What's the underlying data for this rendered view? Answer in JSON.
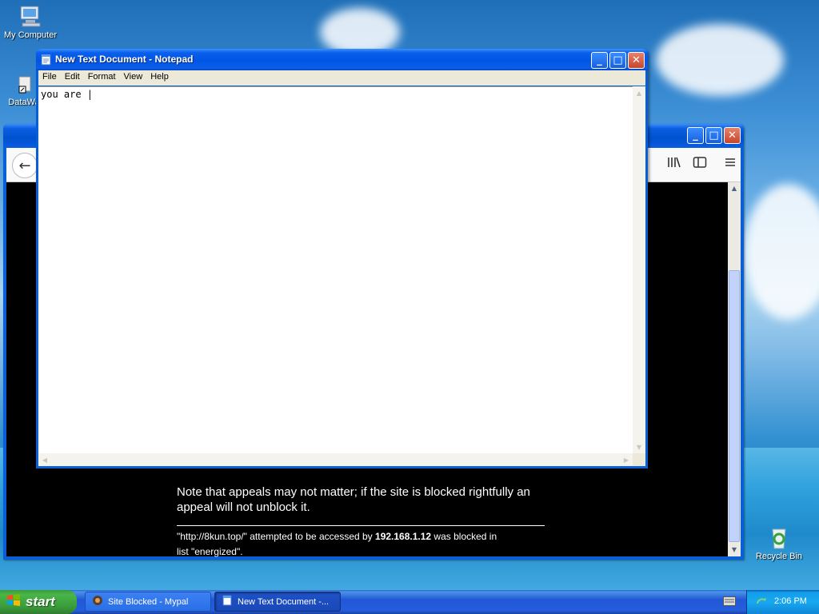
{
  "desktop": {
    "icons": [
      {
        "label": "My Computer",
        "icon": "computer-icon"
      },
      {
        "label": "DataWa",
        "icon": "datawarehouse-icon"
      },
      {
        "label": "Recycle Bin",
        "icon": "recycle-bin-icon"
      }
    ]
  },
  "notepad": {
    "title": "New Text Document - Notepad",
    "menu": [
      "File",
      "Edit",
      "Format",
      "View",
      "Help"
    ],
    "content": "you are |"
  },
  "browser": {
    "note_text": "Note that appeals may not matter; if the site is blocked rightfully an appeal will not unblock it.",
    "blocked_prefix": "\"http://8kun.top/\" attempted to be accessed by ",
    "blocked_ip": "192.168.1.12",
    "blocked_mid": " was blocked in",
    "blocked_suffix": "list \"energized\"."
  },
  "taskbar": {
    "start_label": "start",
    "tasks": [
      {
        "label": "Site Blocked - Mypal",
        "active": false
      },
      {
        "label": "New Text Document -...",
        "active": true
      }
    ],
    "clock": "2:06 PM"
  },
  "colors": {
    "title_blue": "#0055e5",
    "start_green": "#3a9b3a",
    "close_red": "#c8452c"
  }
}
